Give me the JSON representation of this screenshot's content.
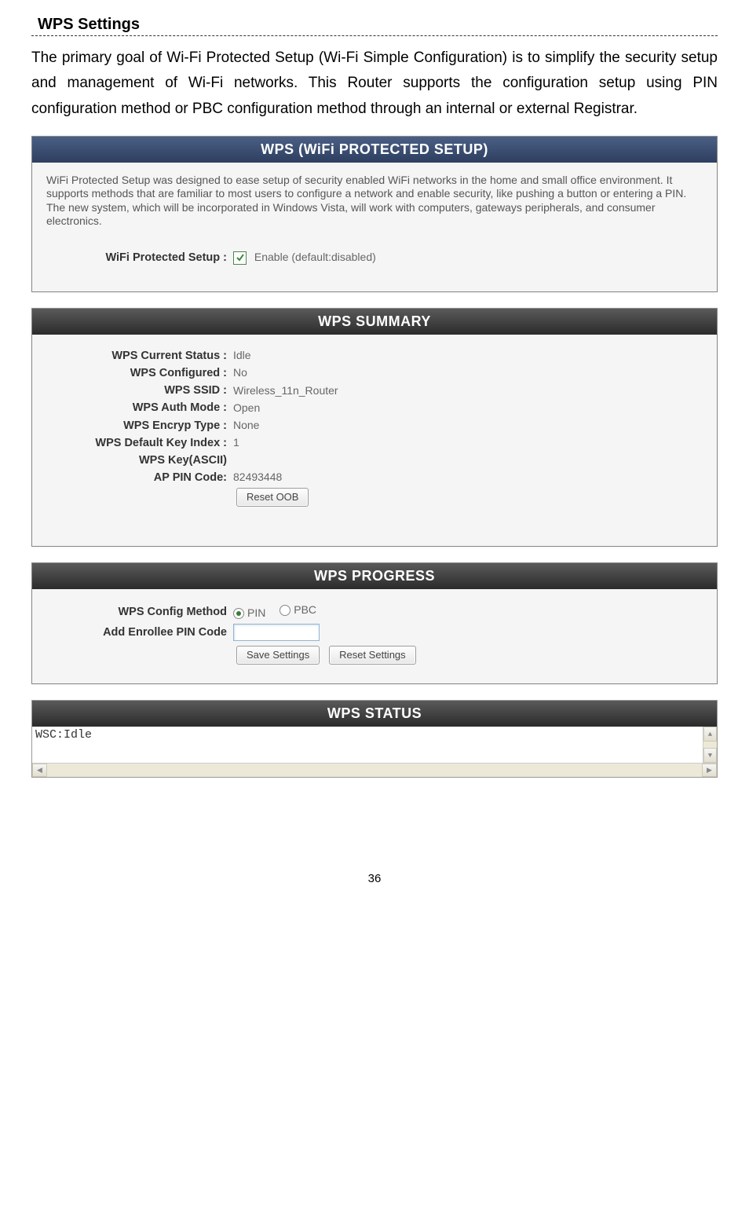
{
  "page": {
    "title": "WPS Settings",
    "intro": "The primary goal of Wi-Fi Protected Setup (Wi-Fi Simple Configuration) is to simplify the security setup and management of Wi-Fi networks. This Router supports the configuration setup using PIN configuration method or PBC configuration method through an internal or external Registrar.",
    "page_number": "36"
  },
  "setup_panel": {
    "title": "WPS (WiFi PROTECTED SETUP)",
    "description": "WiFi Protected Setup was designed to ease setup of security enabled WiFi networks in the home and small office environment. It supports methods that are familiar to most users to configure a network and enable security, like pushing a button or entering a PIN. The new system, which will be incorporated in Windows Vista, will work with computers, gateways peripherals, and consumer electronics.",
    "enable_label": "WiFi Protected Setup :",
    "enable_text": "Enable (default:disabled)",
    "enable_checked": true
  },
  "summary_panel": {
    "title": "WPS SUMMARY",
    "rows": [
      {
        "label": "WPS Current Status :",
        "value": "Idle"
      },
      {
        "label": "WPS Configured :",
        "value": "No"
      },
      {
        "label": "WPS SSID :",
        "value": "Wireless_11n_Router"
      },
      {
        "label": "WPS Auth Mode :",
        "value": "Open"
      },
      {
        "label": "WPS Encryp Type :",
        "value": "None"
      },
      {
        "label": "WPS Default Key Index :",
        "value": "1"
      },
      {
        "label": "WPS Key(ASCII)",
        "value": ""
      },
      {
        "label": "AP PIN Code:",
        "value": "82493448"
      }
    ],
    "reset_oob": "Reset OOB"
  },
  "progress_panel": {
    "title": "WPS PROGRESS",
    "config_method_label": "WPS Config Method",
    "pin_label": "PIN",
    "pbc_label": "PBC",
    "pin_selected": true,
    "enrollee_label": "Add Enrollee PIN Code",
    "enrollee_value": "",
    "save_btn": "Save Settings",
    "reset_btn": "Reset Settings"
  },
  "status_panel": {
    "title": "WPS STATUS",
    "text": "WSC:Idle"
  }
}
